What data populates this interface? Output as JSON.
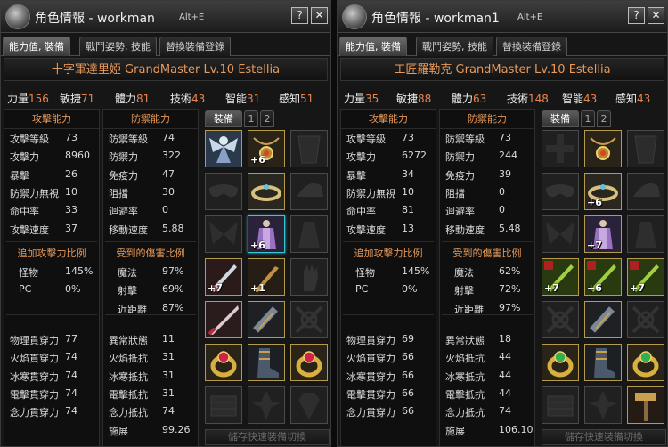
{
  "panels": [
    {
      "title": "角色情報 - workman",
      "shortcut": "Alt+E",
      "tabs": [
        "能力值, 裝備",
        "戰鬥姿勢, 技能",
        "替換裝備登錄"
      ],
      "character": "十字軍達里婭  GrandMaster Lv.10  Estellia",
      "stats": [
        {
          "k": "力量",
          "v": "156"
        },
        {
          "k": "敏捷",
          "v": "71"
        },
        {
          "k": "體力",
          "v": "81"
        },
        {
          "k": "技術",
          "v": "43"
        },
        {
          "k": "智能",
          "v": "31"
        },
        {
          "k": "感知",
          "v": "51"
        }
      ],
      "attack": {
        "title": "攻擊能力",
        "rows": [
          {
            "k": "攻擊等級",
            "v": "73"
          },
          {
            "k": "攻擊力",
            "v": "8960"
          },
          {
            "k": "暴擊",
            "v": "26"
          },
          {
            "k": "防禦力無視",
            "v": "10"
          },
          {
            "k": "命中率",
            "v": "33"
          },
          {
            "k": "攻擊速度",
            "v": "37"
          }
        ]
      },
      "attack_extra": {
        "title": "追加攻擊力比例",
        "rows": [
          {
            "k": "怪物",
            "v": "145%"
          },
          {
            "k": "PC",
            "v": "0%"
          }
        ]
      },
      "penetration": [
        {
          "k": "物理貫穿力",
          "v": "77"
        },
        {
          "k": "火焰貫穿力",
          "v": "74"
        },
        {
          "k": "冰寒貫穿力",
          "v": "74"
        },
        {
          "k": "電擊貫穿力",
          "v": "74"
        },
        {
          "k": "念力貫穿力",
          "v": "74"
        }
      ],
      "defense": {
        "title": "防禦能力",
        "rows": [
          {
            "k": "防禦等級",
            "v": "74"
          },
          {
            "k": "防禦力",
            "v": "322"
          },
          {
            "k": "免疫力",
            "v": "47"
          },
          {
            "k": "阻擋",
            "v": "30"
          },
          {
            "k": "迴避率",
            "v": "0"
          },
          {
            "k": "移動速度",
            "v": "5.88"
          }
        ]
      },
      "damage_taken": {
        "title": "受到的傷害比例",
        "rows": [
          {
            "k": "魔法",
            "v": "97%"
          },
          {
            "k": "射擊",
            "v": "69%"
          },
          {
            "k": "近距離",
            "v": "87%"
          }
        ]
      },
      "resist": [
        {
          "k": "異常狀態",
          "v": "11"
        },
        {
          "k": "火焰抵抗",
          "v": "31"
        },
        {
          "k": "冰寒抵抗",
          "v": "31"
        },
        {
          "k": "電擊抵抗",
          "v": "31"
        },
        {
          "k": "念力抵抗",
          "v": "74"
        },
        {
          "k": "施展",
          "v": "99.26"
        }
      ],
      "equip_tabs": [
        "裝備",
        "1",
        "2"
      ],
      "slots": [
        {
          "icon": "angel-figure-icon",
          "plus": "",
          "style": "gold"
        },
        {
          "icon": "pendant-icon",
          "plus": "+6",
          "style": "gold"
        },
        {
          "icon": "cape-placeholder-icon",
          "plus": "",
          "style": "ghost"
        },
        {
          "icon": "mask-placeholder-icon",
          "plus": "",
          "style": "ghost"
        },
        {
          "icon": "circlet-icon",
          "plus": "",
          "style": "gold"
        },
        {
          "icon": "hat-placeholder-icon",
          "plus": "",
          "style": "ghost"
        },
        {
          "icon": "wings-placeholder-icon",
          "plus": "",
          "style": "ghost"
        },
        {
          "icon": "armor-costume-icon",
          "plus": "+6",
          "style": "cyan"
        },
        {
          "icon": "outfit-placeholder-icon",
          "plus": "",
          "style": "ghost"
        },
        {
          "icon": "sword-weapon-icon",
          "plus": "+7",
          "style": "gold"
        },
        {
          "icon": "knife-weapon-icon",
          "plus": "+1",
          "style": "gold"
        },
        {
          "icon": "gloves-placeholder-icon",
          "plus": "",
          "style": "ghost"
        },
        {
          "icon": "blade-weapon-icon",
          "plus": "",
          "style": "gold"
        },
        {
          "icon": "bracer-icon",
          "plus": "",
          "style": "gold"
        },
        {
          "icon": "weapon-placeholder-icon",
          "plus": "",
          "style": "ghost"
        },
        {
          "icon": "ring-ruby-icon",
          "plus": "",
          "style": "gold"
        },
        {
          "icon": "boots-icon",
          "plus": "",
          "style": "gold"
        },
        {
          "icon": "ring-ruby-icon",
          "plus": "",
          "style": "gold"
        },
        {
          "icon": "belt-placeholder-icon",
          "plus": "",
          "style": "ghost"
        },
        {
          "icon": "fleur-placeholder-icon",
          "plus": "",
          "style": "ghost"
        },
        {
          "icon": "gem-placeholder-icon",
          "plus": "",
          "style": "ghost"
        }
      ],
      "quick_swap": "儲存快速裝備切換"
    },
    {
      "title": "角色情報 - workman1",
      "shortcut": "Alt+E",
      "tabs": [
        "能力值, 裝備",
        "戰鬥姿勢, 技能",
        "替換裝備登錄"
      ],
      "character": "工匠羅勒克  GrandMaster Lv.10  Estellia",
      "stats": [
        {
          "k": "力量",
          "v": "35"
        },
        {
          "k": "敏捷",
          "v": "88"
        },
        {
          "k": "體力",
          "v": "63"
        },
        {
          "k": "技術",
          "v": "148"
        },
        {
          "k": "智能",
          "v": "43"
        },
        {
          "k": "感知",
          "v": "43"
        }
      ],
      "attack": {
        "title": "攻擊能力",
        "rows": [
          {
            "k": "攻擊等級",
            "v": "73"
          },
          {
            "k": "攻擊力",
            "v": "6272"
          },
          {
            "k": "暴擊",
            "v": "34"
          },
          {
            "k": "防禦力無視",
            "v": "10"
          },
          {
            "k": "命中率",
            "v": "81"
          },
          {
            "k": "攻擊速度",
            "v": "13"
          }
        ]
      },
      "attack_extra": {
        "title": "追加攻擊力比例",
        "rows": [
          {
            "k": "怪物",
            "v": "145%"
          },
          {
            "k": "PC",
            "v": "0%"
          }
        ]
      },
      "penetration": [
        {
          "k": "物理貫穿力",
          "v": "69"
        },
        {
          "k": "火焰貫穿力",
          "v": "66"
        },
        {
          "k": "冰寒貫穿力",
          "v": "66"
        },
        {
          "k": "電擊貫穿力",
          "v": "66"
        },
        {
          "k": "念力貫穿力",
          "v": "66"
        }
      ],
      "defense": {
        "title": "防禦能力",
        "rows": [
          {
            "k": "防禦等級",
            "v": "73"
          },
          {
            "k": "防禦力",
            "v": "244"
          },
          {
            "k": "免疫力",
            "v": "39"
          },
          {
            "k": "阻擋",
            "v": "0"
          },
          {
            "k": "迴避率",
            "v": "0"
          },
          {
            "k": "移動速度",
            "v": "5.48"
          }
        ]
      },
      "damage_taken": {
        "title": "受到的傷害比例",
        "rows": [
          {
            "k": "魔法",
            "v": "62%"
          },
          {
            "k": "射擊",
            "v": "72%"
          },
          {
            "k": "近距離",
            "v": "97%"
          }
        ]
      },
      "resist": [
        {
          "k": "異常狀態",
          "v": "18"
        },
        {
          "k": "火焰抵抗",
          "v": "44"
        },
        {
          "k": "冰寒抵抗",
          "v": "44"
        },
        {
          "k": "電擊抵抗",
          "v": "44"
        },
        {
          "k": "念力抵抗",
          "v": "74"
        },
        {
          "k": "施展",
          "v": "106.10"
        }
      ],
      "equip_tabs": [
        "裝備",
        "1",
        "2"
      ],
      "slots": [
        {
          "icon": "cross-placeholder-icon",
          "plus": "",
          "style": "ghost"
        },
        {
          "icon": "pendant-icon",
          "plus": "",
          "style": "gold"
        },
        {
          "icon": "cape-placeholder-icon",
          "plus": "",
          "style": "ghost"
        },
        {
          "icon": "mask-placeholder-icon",
          "plus": "",
          "style": "ghost"
        },
        {
          "icon": "circlet-icon",
          "plus": "+6",
          "style": "gold"
        },
        {
          "icon": "hat-placeholder-icon",
          "plus": "",
          "style": "ghost"
        },
        {
          "icon": "wings-placeholder-icon",
          "plus": "",
          "style": "ghost"
        },
        {
          "icon": "armor-costume-icon",
          "plus": "+7",
          "style": "gold"
        },
        {
          "icon": "outfit-placeholder-icon",
          "plus": "",
          "style": "ghost"
        },
        {
          "icon": "green-weapon-icon",
          "plus": "+7",
          "style": "gold"
        },
        {
          "icon": "green-weapon-icon",
          "plus": "+6",
          "style": "gold"
        },
        {
          "icon": "green-weapon-icon",
          "plus": "+7",
          "style": "gold"
        },
        {
          "icon": "weapon-placeholder-icon",
          "plus": "",
          "style": "ghost"
        },
        {
          "icon": "bracer-icon",
          "plus": "",
          "style": "gold"
        },
        {
          "icon": "weapon-placeholder-icon",
          "plus": "",
          "style": "ghost"
        },
        {
          "icon": "ring-emerald-icon",
          "plus": "",
          "style": "gold"
        },
        {
          "icon": "boots-icon",
          "plus": "",
          "style": "gold"
        },
        {
          "icon": "ring-emerald-icon",
          "plus": "",
          "style": "gold"
        },
        {
          "icon": "belt-placeholder-icon",
          "plus": "",
          "style": "ghost"
        },
        {
          "icon": "fleur-placeholder-icon",
          "plus": "",
          "style": "ghost"
        },
        {
          "icon": "hammer-tool-icon",
          "plus": "",
          "style": "gold"
        }
      ],
      "quick_swap": "儲存快速裝備切換"
    }
  ],
  "colors": {
    "accent_orange": "#e8844c",
    "header_orange": "#e89a5a",
    "cyan_highlight": "#38c6d8",
    "gold_border": "#b59a4a"
  }
}
